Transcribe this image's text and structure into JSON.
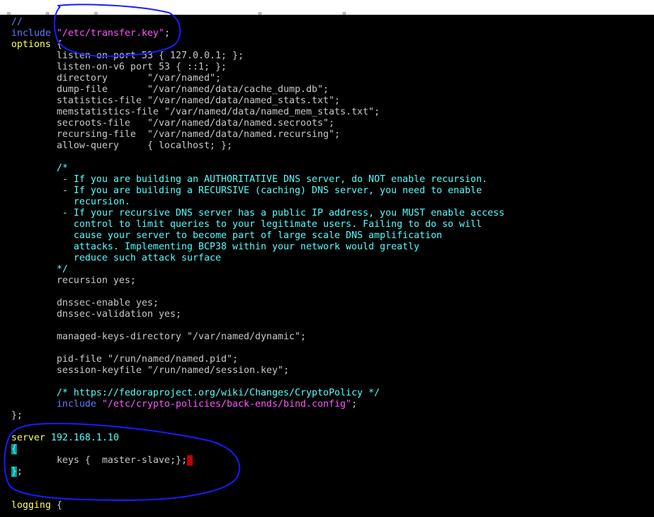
{
  "window": {
    "title": ""
  },
  "editor": {
    "lines": [
      {
        "parts": [
          {
            "t": "//",
            "c": "c-blue"
          }
        ]
      },
      {
        "parts": [
          {
            "t": "include ",
            "c": "c-blue"
          },
          {
            "t": "\"/etc/transfer.key\"",
            "c": "c-mag"
          },
          {
            "t": ";",
            "c": "c-gray"
          }
        ]
      },
      {
        "parts": [
          {
            "t": "options",
            "c": "c-yellow"
          },
          {
            "t": " {",
            "c": "c-gray"
          }
        ]
      },
      {
        "parts": [
          {
            "t": "        listen-on port 53 { 127.0.0.1; };",
            "c": "c-gray"
          }
        ]
      },
      {
        "parts": [
          {
            "t": "        listen-on-v6 port 53 { ::1; };",
            "c": "c-gray"
          }
        ]
      },
      {
        "parts": [
          {
            "t": "        directory       \"/var/named\";",
            "c": "c-gray"
          }
        ]
      },
      {
        "parts": [
          {
            "t": "        dump-file       \"/var/named/data/cache_dump.db\";",
            "c": "c-gray"
          }
        ]
      },
      {
        "parts": [
          {
            "t": "        statistics-file \"/var/named/data/named_stats.txt\";",
            "c": "c-gray"
          }
        ]
      },
      {
        "parts": [
          {
            "t": "        memstatistics-file \"/var/named/data/named_mem_stats.txt\";",
            "c": "c-gray"
          }
        ]
      },
      {
        "parts": [
          {
            "t": "        secroots-file   \"/var/named/data/named.secroots\";",
            "c": "c-gray"
          }
        ]
      },
      {
        "parts": [
          {
            "t": "        recursing-file  \"/var/named/data/named.recursing\";",
            "c": "c-gray"
          }
        ]
      },
      {
        "parts": [
          {
            "t": "        allow-query     { localhost; };",
            "c": "c-gray"
          }
        ]
      },
      {
        "parts": [
          {
            "t": "",
            "c": "c-gray"
          }
        ]
      },
      {
        "parts": [
          {
            "t": "        /*",
            "c": "c-cyan"
          }
        ]
      },
      {
        "parts": [
          {
            "t": "         - If you are building an AUTHORITATIVE DNS server, do NOT enable recursion.",
            "c": "c-cyan"
          }
        ]
      },
      {
        "parts": [
          {
            "t": "         - If you are building a RECURSIVE (caching) DNS server, you need to enable",
            "c": "c-cyan"
          }
        ]
      },
      {
        "parts": [
          {
            "t": "           recursion.",
            "c": "c-cyan"
          }
        ]
      },
      {
        "parts": [
          {
            "t": "         - If your recursive DNS server has a public IP address, you MUST enable access",
            "c": "c-cyan"
          }
        ]
      },
      {
        "parts": [
          {
            "t": "           control to limit queries to your legitimate users. Failing to do so will",
            "c": "c-cyan"
          }
        ]
      },
      {
        "parts": [
          {
            "t": "           cause your server to become part of large scale DNS amplification",
            "c": "c-cyan"
          }
        ]
      },
      {
        "parts": [
          {
            "t": "           attacks. Implementing BCP38 within your network would greatly",
            "c": "c-cyan"
          }
        ]
      },
      {
        "parts": [
          {
            "t": "           reduce such attack surface",
            "c": "c-cyan"
          }
        ]
      },
      {
        "parts": [
          {
            "t": "        */",
            "c": "c-cyan"
          }
        ]
      },
      {
        "parts": [
          {
            "t": "        recursion yes;",
            "c": "c-gray"
          }
        ]
      },
      {
        "parts": [
          {
            "t": "",
            "c": "c-gray"
          }
        ]
      },
      {
        "parts": [
          {
            "t": "        dnssec-enable yes;",
            "c": "c-gray"
          }
        ]
      },
      {
        "parts": [
          {
            "t": "        dnssec-validation yes;",
            "c": "c-gray"
          }
        ]
      },
      {
        "parts": [
          {
            "t": "",
            "c": "c-gray"
          }
        ]
      },
      {
        "parts": [
          {
            "t": "        managed-keys-directory \"/var/named/dynamic\";",
            "c": "c-gray"
          }
        ]
      },
      {
        "parts": [
          {
            "t": "",
            "c": "c-gray"
          }
        ]
      },
      {
        "parts": [
          {
            "t": "        pid-file \"/run/named/named.pid\";",
            "c": "c-gray"
          }
        ]
      },
      {
        "parts": [
          {
            "t": "        session-keyfile \"/run/named/session.key\";",
            "c": "c-gray"
          }
        ]
      },
      {
        "parts": [
          {
            "t": "",
            "c": "c-gray"
          }
        ]
      },
      {
        "parts": [
          {
            "t": "        /* https://fedoraproject.org/wiki/Changes/CryptoPolicy */",
            "c": "c-cyan"
          }
        ]
      },
      {
        "parts": [
          {
            "t": "        include ",
            "c": "c-blue"
          },
          {
            "t": "\"/etc/crypto-policies/back-ends/bind.config\"",
            "c": "c-mag"
          },
          {
            "t": ";",
            "c": "c-gray"
          }
        ]
      },
      {
        "parts": [
          {
            "t": "};",
            "c": "c-gray"
          }
        ]
      },
      {
        "parts": [
          {
            "t": "",
            "c": "c-gray"
          }
        ]
      },
      {
        "parts": [
          {
            "t": "server",
            "c": "c-yellow"
          },
          {
            "t": " 192.168.1.10",
            "c": "c-cyan"
          }
        ]
      },
      {
        "parts": [
          {
            "t": "{",
            "c": "cur-teal"
          }
        ]
      },
      {
        "parts": [
          {
            "t": "        keys {  master-slave;};",
            "c": "c-gray"
          },
          {
            "cursor": true
          }
        ]
      },
      {
        "parts": [
          {
            "t": "}",
            "c": "cur-teal"
          },
          {
            "t": ";",
            "c": "c-gray"
          }
        ]
      },
      {
        "parts": [
          {
            "t": "",
            "c": "c-gray"
          }
        ]
      },
      {
        "parts": [
          {
            "t": "",
            "c": "c-gray"
          }
        ]
      },
      {
        "parts": [
          {
            "t": "logging",
            "c": "c-yellow"
          },
          {
            "t": " {",
            "c": "c-gray"
          }
        ]
      }
    ]
  },
  "annotations": {
    "color": "#1a1aff"
  }
}
